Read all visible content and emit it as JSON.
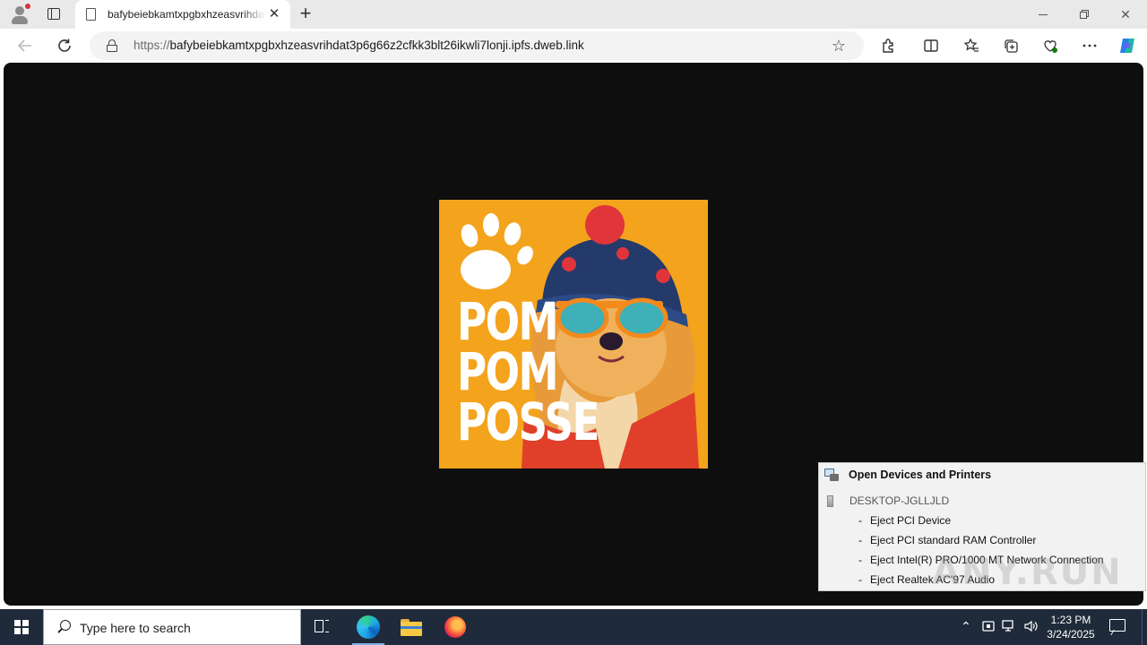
{
  "browser": {
    "tab": {
      "title": "bafybeiebkamtxpgbxhzeasvrihdat3p6g66z2cfkk3blt26ikwli7lonji.ipfs.dweb.link",
      "close_glyph": "✕"
    },
    "new_tab_glyph": "+",
    "address": {
      "scheme": "https://",
      "host": "bafybeiebkamtxpgbxhzeasvrihdat3p6g66z2cfkk3blt26ikwli7lonji.ipfs.dweb.link"
    },
    "toolbar_icons": [
      "extensions-icon",
      "split-screen-icon",
      "favorites-icon",
      "collections-icon",
      "browser-essentials-icon",
      "more-icon",
      "copilot-icon"
    ]
  },
  "page": {
    "artwork": {
      "line1": "POM",
      "line2": "POM",
      "line3": "POSSE",
      "background_color": "#f4a31d"
    }
  },
  "popup": {
    "title": "Open Devices and Printers",
    "computer": "DESKTOP-JGLLJLD",
    "items": [
      "Eject PCI Device",
      "Eject PCI standard RAM Controller",
      "Eject Intel(R) PRO/1000 MT Network Connection",
      "Eject Realtek AC'97 Audio"
    ]
  },
  "watermark": "ANY.RUN",
  "taskbar": {
    "search_placeholder": "Type here to search",
    "time": "1:23 PM",
    "date": "3/24/2025",
    "accent_color": "#7fb2e5"
  }
}
